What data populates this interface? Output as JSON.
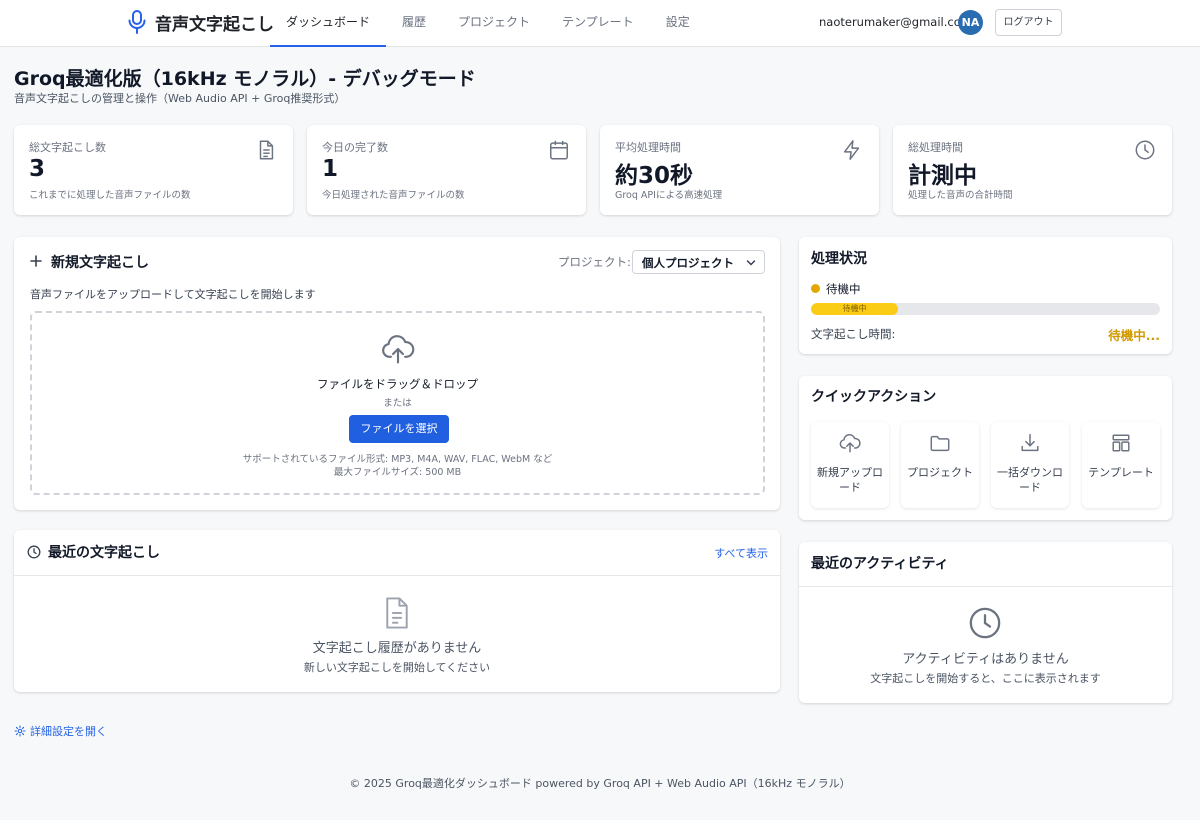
{
  "app": {
    "title": "音声文字起こし"
  },
  "nav": {
    "tabs": [
      {
        "label": "ダッシュボード",
        "active": true
      },
      {
        "label": "履歴"
      },
      {
        "label": "プロジェクト"
      },
      {
        "label": "テンプレート"
      },
      {
        "label": "設定"
      }
    ]
  },
  "user": {
    "email": "naoterumaker@gmail.com",
    "initials": "NA",
    "logout_label": "ログアウト"
  },
  "page": {
    "title": "Groq最適化版（16kHz モノラル）- デバッグモード",
    "subtitle": "音声文字起こしの管理と操作（Web Audio API + Groq推奨形式）"
  },
  "stats": [
    {
      "label": "総文字起こし数",
      "value": "3",
      "caption": "これまでに処理した音声ファイルの数",
      "icon": "document-icon"
    },
    {
      "label": "今日の完了数",
      "value": "1",
      "caption": "今日処理された音声ファイルの数",
      "icon": "calendar-icon"
    },
    {
      "label": "平均処理時間",
      "value": "約30秒",
      "caption": "Groq APIによる高速処理",
      "icon": "lightning-icon"
    },
    {
      "label": "総処理時間",
      "value": "計測中",
      "caption": "処理した音声の合計時間",
      "icon": "clock-icon"
    }
  ],
  "new_transcription": {
    "title": "新規文字起こし",
    "project_label": "プロジェクト:",
    "project_selected": "個人プロジェクト",
    "description": "音声ファイルをアップロードして文字起こしを開始します",
    "drop_title": "ファイルをドラッグ＆ドロップ",
    "drop_or": "または",
    "select_button": "ファイルを選択",
    "supported_formats": "サポートされているファイル形式: MP3, M4A, WAV, FLAC, WebM など",
    "max_size": "最大ファイルサイズ: 500 MB"
  },
  "recent": {
    "title": "最近の文字起こし",
    "view_all": "すべて表示",
    "empty_title": "文字起こし履歴がありません",
    "empty_sub": "新しい文字起こしを開始してください"
  },
  "status": {
    "title": "処理状況",
    "state": "待機中",
    "progress_label": "待機中",
    "progress": 0.25,
    "time_label": "文字起こし時間:",
    "time_value": "待機中...",
    "accent": "#facc15",
    "time_color": "#d19a00"
  },
  "quick_actions": {
    "title": "クイックアクション",
    "items": [
      {
        "label": "新規アップロード",
        "icon": "upload-cloud-icon"
      },
      {
        "label": "プロジェクト",
        "icon": "folder-icon"
      },
      {
        "label": "一括ダウンロード",
        "icon": "download-icon"
      },
      {
        "label": "テンプレート",
        "icon": "template-icon"
      }
    ]
  },
  "activity": {
    "title": "最近のアクティビティ",
    "empty_title": "アクティビティはありません",
    "empty_sub": "文字起こしを開始すると、ここに表示されます"
  },
  "advanced_link": "詳細設定を開く",
  "footer": "© 2025 Groq最適化ダッシュボード powered by Groq API + Web Audio API（16kHz モノラル）",
  "colors": {
    "primary": "#1f5fe0",
    "avatar": "#2a6cb0",
    "link": "#2563eb"
  }
}
